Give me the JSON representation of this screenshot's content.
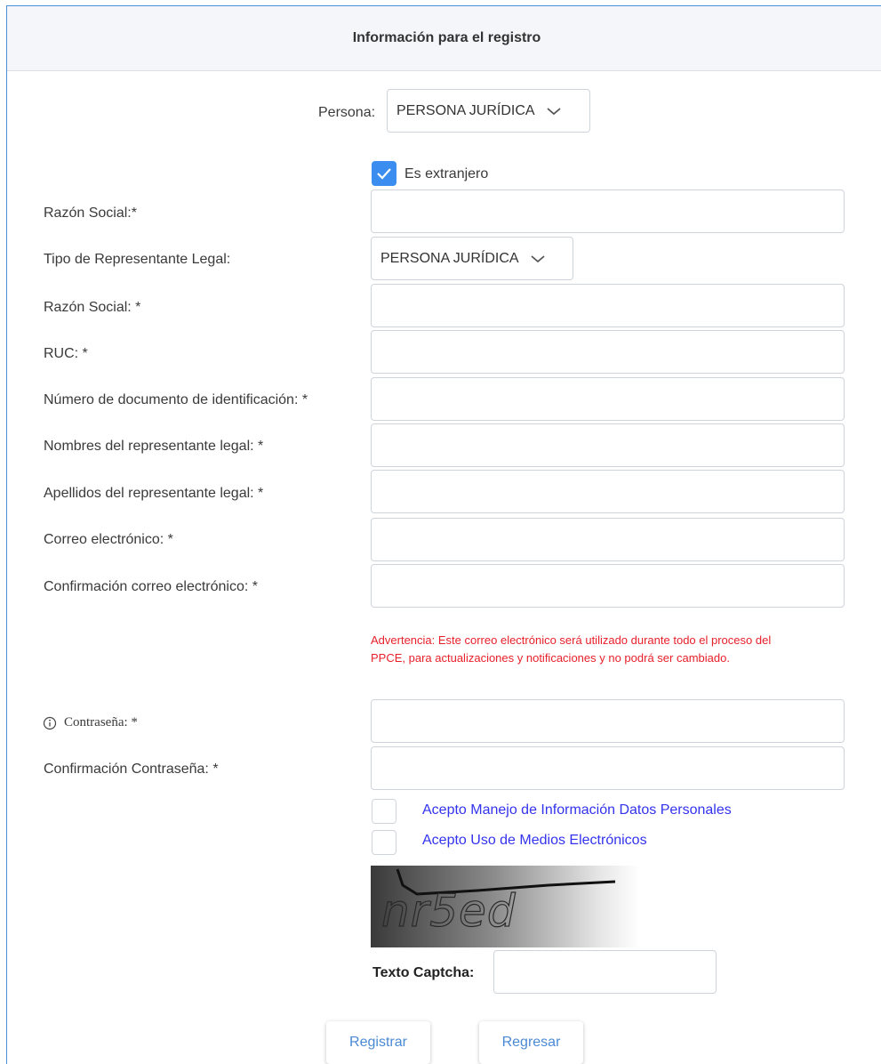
{
  "header": {
    "title": "Información para el registro"
  },
  "persona": {
    "label": "Persona:",
    "value": "PERSONA JURÍDICA"
  },
  "extranjero": {
    "label": "Es extranjero",
    "checked": true
  },
  "fields": {
    "razon_social_1": "Razón Social:*",
    "tipo_representante": "Tipo de Representante Legal:",
    "tipo_representante_value": "PERSONA JURÍDICA",
    "razon_social_2": "Razón Social: *",
    "ruc": "RUC: *",
    "numero_documento": "Número de documento de identificación: *",
    "nombres": "Nombres del representante legal: *",
    "apellidos": "Apellidos del representante legal: *",
    "correo": "Correo electrónico: *",
    "confirmacion_correo": "Confirmación correo electrónico: *",
    "contrasena": "Contraseña:  *",
    "confirmacion_contrasena": "Confirmación Contraseña: *"
  },
  "warning": "Advertencia: Este correo electrónico será utilizado durante todo el proceso del PPCE, para actualizaciones y notificaciones y no podrá ser cambiado.",
  "consents": {
    "datos_personales": "Acepto Manejo de Información Datos Personales",
    "medios_electronicos": "Acepto Uso de Medios Electrónicos"
  },
  "captcha": {
    "image_text": "nr5ed",
    "label": "Texto Captcha:"
  },
  "buttons": {
    "register": "Registrar",
    "back": "Regresar"
  },
  "colors": {
    "accent": "#3b8ef0",
    "link": "#3333ee",
    "warning": "#e8202a",
    "button_text": "#4a8ad4"
  }
}
